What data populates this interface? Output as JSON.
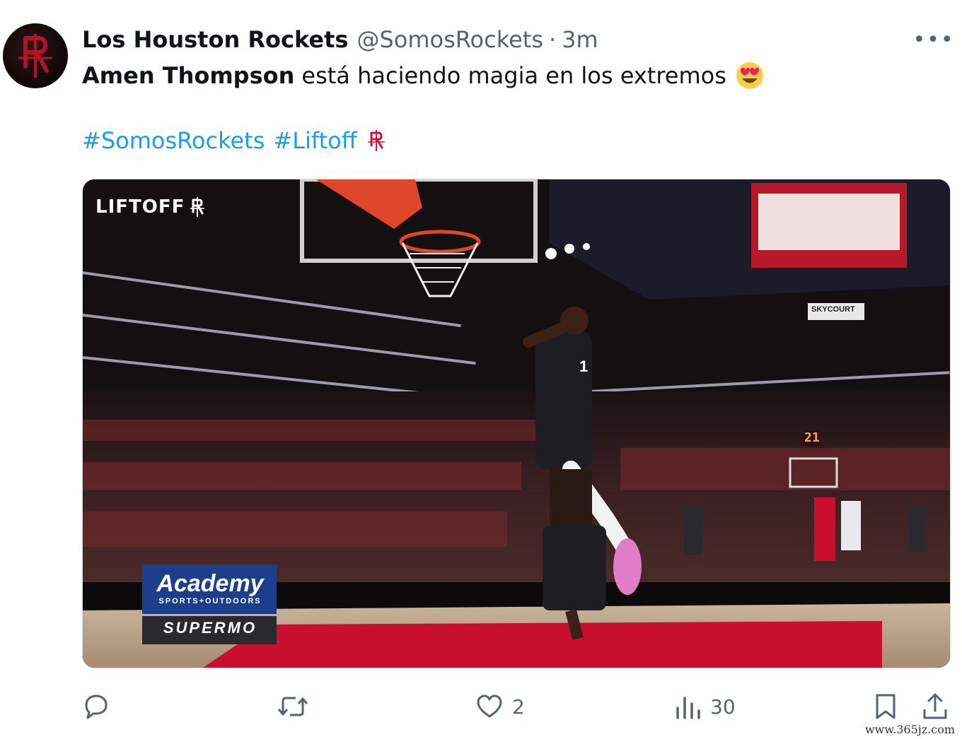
{
  "tweet": {
    "author_name": "Los Houston Rockets",
    "handle": "@SomosRockets",
    "separator": "·",
    "time": "3m",
    "more_label": "•••",
    "text_bold": "Amen Thompson",
    "text_rest": "está haciendo magia en los extremos",
    "emoji": "smiling-face-with-heart-eyes",
    "hashtags": [
      "#SomosRockets",
      "#Liftoff"
    ]
  },
  "media": {
    "overlay_brand": "LIFTOFF",
    "sponsor_main": "Academy",
    "sponsor_sub": "SPORTS+OUTDOORS",
    "sponsor_banner": "SUPERMO",
    "scoreboard_text": "SKYCOURT",
    "shot_clock": "21",
    "player_number": "1"
  },
  "actions": {
    "reply_count": "",
    "retweet_count": "",
    "like_count": "2",
    "views_count": "30"
  },
  "watermark": "www.365jz.com",
  "colors": {
    "link": "#1d9bf0",
    "secondary_text": "#536471",
    "rockets_red": "#ce1141"
  }
}
